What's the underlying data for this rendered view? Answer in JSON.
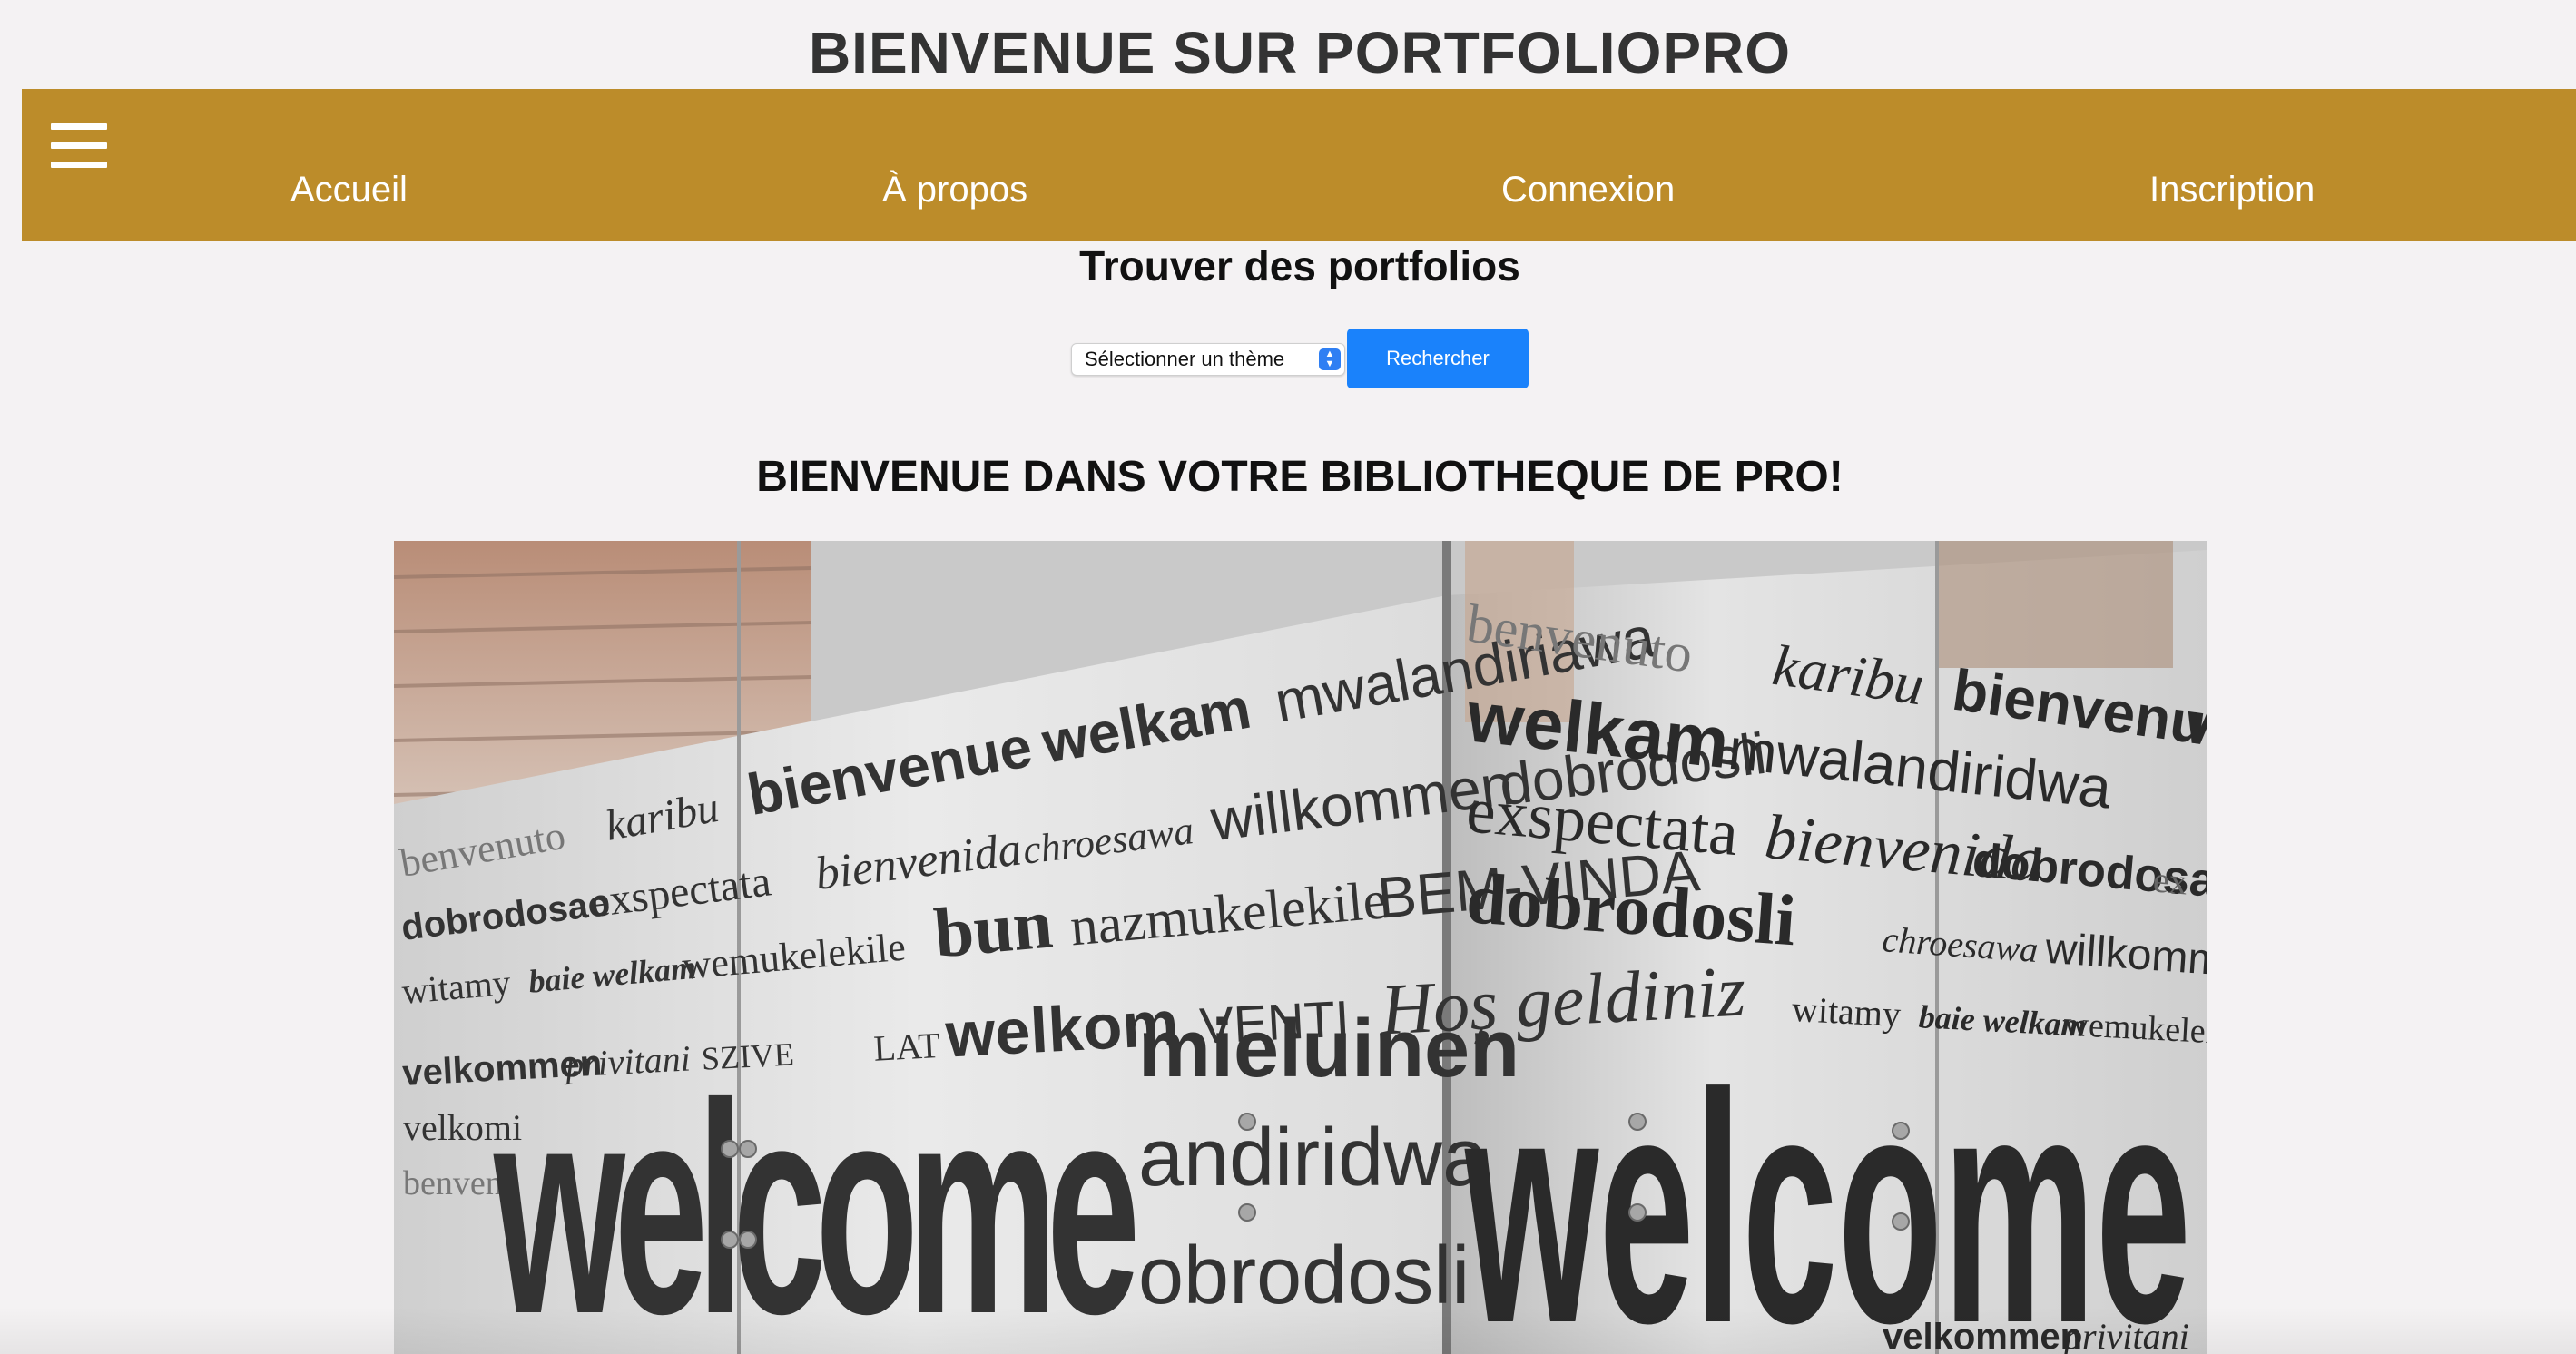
{
  "header": {
    "title": "BIENVENUE SUR PORTFOLIOPRO"
  },
  "nav": {
    "menu_icon": "hamburger-menu-icon",
    "items": [
      {
        "label": "Accueil"
      },
      {
        "label": "À propos"
      },
      {
        "label": "Connexion"
      },
      {
        "label": "Inscription"
      }
    ],
    "background_color": "#bc8c2a"
  },
  "search": {
    "heading": "Trouver des portfolios",
    "select_value": "Sélectionner un thème",
    "button_label": "Rechercher",
    "button_color": "#1a82fb"
  },
  "main": {
    "heading": "BIENVENUE DANS VOTRE BIBLIOTHEQUE DE PRO!",
    "hero": {
      "left_words": [
        "benvenuto",
        "karibu",
        "bienvenue",
        "welkam",
        "mwalandiriawa",
        "dobrodosao",
        "exspectata",
        "bienvenida",
        "chroesawa",
        "willkommen",
        "dobrodosli",
        "witamy",
        "baie welkam",
        "wemukelekile",
        "bun",
        "nazmukelekile",
        "BEM-VINDA",
        "velkommen",
        "privitani",
        "SZIVE",
        "LAT",
        "welkom",
        "VENTI",
        "Hoş geldiniz",
        "mieluinen",
        "velkomi",
        "benvenu",
        "andiridwa",
        "obrodosli",
        "welcome"
      ],
      "right_words": [
        "benvenuto",
        "karibu",
        "bienvenue",
        "we",
        "welkam",
        "mwalandiridwa",
        "dobrodosao",
        "ex",
        "exspectata",
        "bienvenida",
        "chroesawa",
        "willkommen",
        "dobrodosli",
        "witamy",
        "baie welkam",
        "wemukelekile",
        "welcome",
        "velkommen",
        "privitani"
      ]
    }
  }
}
